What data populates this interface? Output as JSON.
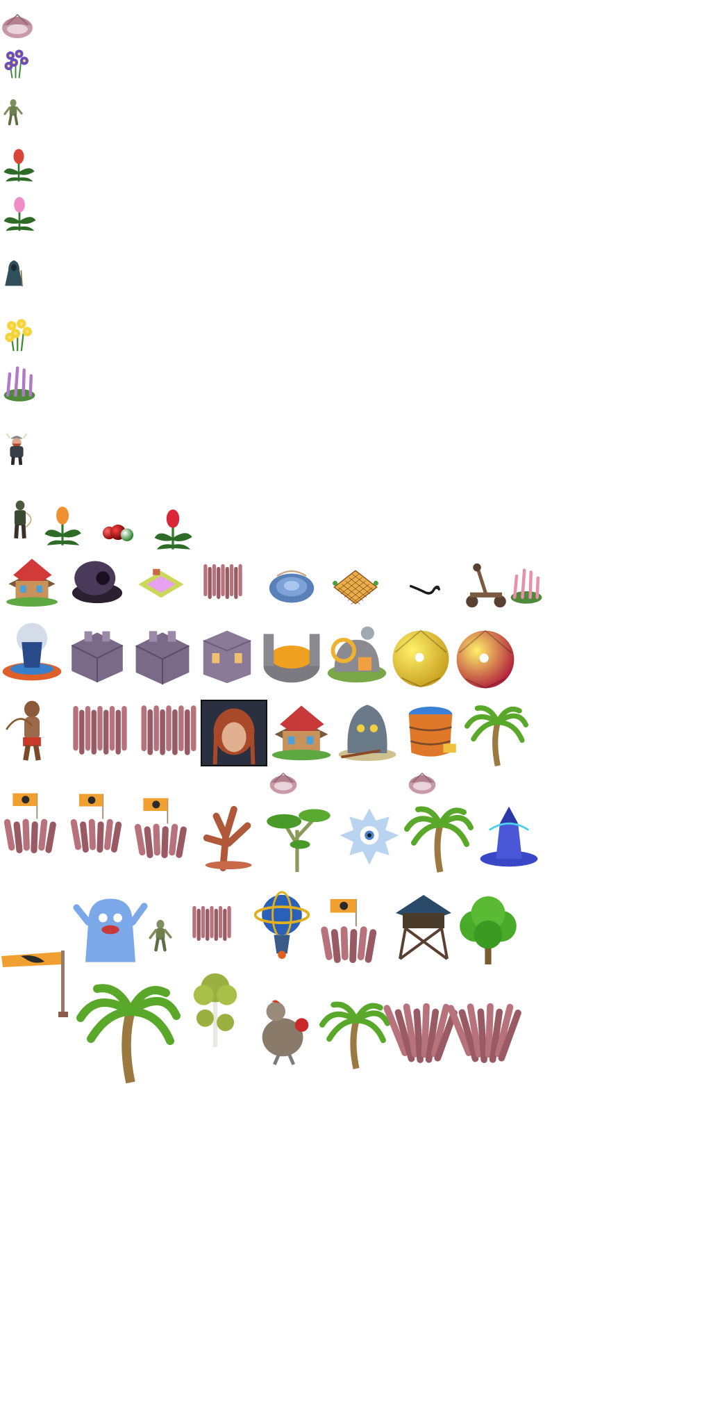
{
  "atlas": {
    "background": "#ffffff",
    "sprites": [
      {
        "name": "clam-shell",
        "kind": "shell"
      },
      {
        "name": "purple-flowers",
        "kind": "flowers",
        "color": "#6a4fb8"
      },
      {
        "name": "zombie-small",
        "kind": "zombie"
      },
      {
        "name": "red-flower-plant",
        "kind": "flower",
        "color": "#d8463a"
      },
      {
        "name": "pink-lily-plant",
        "kind": "flower",
        "color": "#f08cc8"
      },
      {
        "name": "hooded-figure",
        "kind": "hooded"
      },
      {
        "name": "daffodils",
        "kind": "flowers",
        "color": "#f5d43a"
      },
      {
        "name": "heather-plant",
        "kind": "bush",
        "color": "#b07ac8"
      },
      {
        "name": "viking-warrior",
        "kind": "viking"
      },
      {
        "name": "archer-soldier",
        "kind": "soldier"
      },
      {
        "name": "orange-bromeliad",
        "kind": "flower",
        "color": "#f09030"
      },
      {
        "name": "red-green-orbs",
        "kind": "orbs"
      },
      {
        "name": "red-bromeliad",
        "kind": "flower",
        "color": "#d8283a"
      },
      {
        "name": "red-roof-house",
        "kind": "house",
        "color": "#d23a3a"
      },
      {
        "name": "dark-cannon-bunker",
        "kind": "bunker"
      },
      {
        "name": "pink-tile-pad",
        "kind": "pad",
        "color": "#e8a0f0"
      },
      {
        "name": "wooden-wall-segment",
        "kind": "fence"
      },
      {
        "name": "blue-circular-platform",
        "kind": "platform"
      },
      {
        "name": "tiled-plaza",
        "kind": "plaza"
      },
      {
        "name": "black-serpent",
        "kind": "serpent"
      },
      {
        "name": "catapult",
        "kind": "catapult"
      },
      {
        "name": "pink-heather-bush",
        "kind": "bush",
        "color": "#e890a8"
      },
      {
        "name": "blue-potion-fountain",
        "kind": "fountain"
      },
      {
        "name": "stone-wall-block-1",
        "kind": "stonewall"
      },
      {
        "name": "stone-wall-block-2",
        "kind": "stonewall"
      },
      {
        "name": "stone-tower",
        "kind": "stonetower"
      },
      {
        "name": "gold-vault",
        "kind": "vault"
      },
      {
        "name": "workshop",
        "kind": "workshop"
      },
      {
        "name": "gold-gem-ball",
        "kind": "gem",
        "color": "#c8a020"
      },
      {
        "name": "red-gem-ball",
        "kind": "gem",
        "color": "#b0203a"
      },
      {
        "name": "monkey-archer",
        "kind": "monkey"
      },
      {
        "name": "wooden-spike-fence-1",
        "kind": "fence"
      },
      {
        "name": "wooden-spike-fence-2",
        "kind": "fence"
      },
      {
        "name": "braided-hair-portrait",
        "kind": "portrait"
      },
      {
        "name": "blue-brick-house",
        "kind": "house",
        "color": "#c83a3a"
      },
      {
        "name": "skull-mine-cave",
        "kind": "cave"
      },
      {
        "name": "barrel-pool",
        "kind": "barrel"
      },
      {
        "name": "palm-tree-small",
        "kind": "palm"
      },
      {
        "name": "flag-barricade-1",
        "kind": "flagfence"
      },
      {
        "name": "flag-barricade-2",
        "kind": "flagfence"
      },
      {
        "name": "flag-barricade-3",
        "kind": "flagfence"
      },
      {
        "name": "spooky-tree",
        "kind": "spookytree"
      },
      {
        "name": "clam-shell-2",
        "kind": "shell"
      },
      {
        "name": "acacia-tree",
        "kind": "acacia"
      },
      {
        "name": "eye-spirit",
        "kind": "eyespirit"
      },
      {
        "name": "clam-shell-3",
        "kind": "shell"
      },
      {
        "name": "palm-tree-medium",
        "kind": "palm"
      },
      {
        "name": "wizard-tower",
        "kind": "wizardtower"
      },
      {
        "name": "dragon-flag-pole",
        "kind": "flagpole"
      },
      {
        "name": "blue-jelly-ghost",
        "kind": "ghost"
      },
      {
        "name": "zombie-walker",
        "kind": "zombie"
      },
      {
        "name": "wooden-palisade",
        "kind": "fence"
      },
      {
        "name": "orbit-globe-machine",
        "kind": "globe"
      },
      {
        "name": "flag-barricade-4",
        "kind": "flagfence"
      },
      {
        "name": "watchtower",
        "kind": "watchtower"
      },
      {
        "name": "leafy-tree",
        "kind": "leafytree"
      },
      {
        "name": "palm-tree-large",
        "kind": "palm"
      },
      {
        "name": "birch-tree",
        "kind": "birch"
      },
      {
        "name": "robot-chicken",
        "kind": "chicken"
      },
      {
        "name": "palm-tree-tall",
        "kind": "palm"
      },
      {
        "name": "wooden-spike-wall-1",
        "kind": "bigfence"
      },
      {
        "name": "wooden-spike-wall-2",
        "kind": "bigfence"
      }
    ]
  }
}
